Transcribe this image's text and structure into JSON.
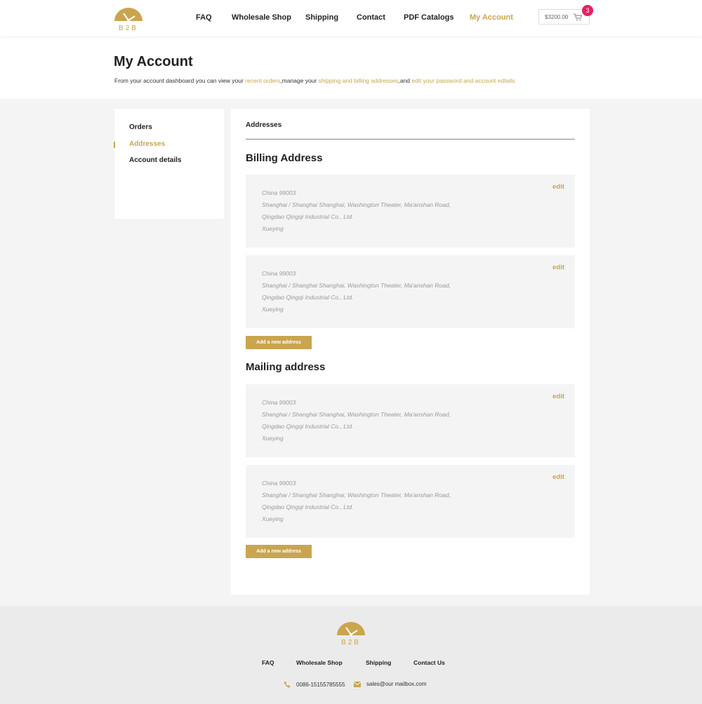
{
  "header": {
    "nav": [
      {
        "label": "FAQ",
        "active": false
      },
      {
        "label": "Wholesale Shop",
        "active": false
      },
      {
        "label": "Shipping",
        "active": false
      },
      {
        "label": "Contact",
        "active": false
      },
      {
        "label": "PDF Catalogs",
        "active": false
      },
      {
        "label": "My Account",
        "active": true
      }
    ],
    "cart_total": "$3200.00",
    "cart_count": "3",
    "logo_text": "B2B"
  },
  "page": {
    "title": "My Account",
    "intro_prefix": "From your account dashboard you can view your ",
    "intro_link1": "recent orders",
    "intro_mid1": ",manage your ",
    "intro_link2": "shipping and billing addresses",
    "intro_mid2": ",and ",
    "intro_link3": "edit your password and account edtails"
  },
  "sidebar": {
    "items": [
      {
        "label": "Orders",
        "active": false
      },
      {
        "label": "Addresses",
        "active": true
      },
      {
        "label": "Account details",
        "active": false
      }
    ]
  },
  "main": {
    "tab_label": "Addresses",
    "billing_title": "Billing Address",
    "mailing_title": "Mailing address",
    "edit_label": "edit",
    "add_button_label": "Add a new  address",
    "billing_addresses": [
      {
        "line1": "China 99003",
        "line2": "Shanghai / Shanghai Shanghai, Washington Theater, Ma'anshan Road,",
        "line3": "Qingdao Qingqi Industrial Co., Ltd.",
        "line4": "Xueying"
      },
      {
        "line1": "China 99003",
        "line2": "Shanghai / Shanghai Shanghai, Washington Theater, Ma'anshan Road,",
        "line3": "Qingdao Qingqi Industrial Co., Ltd.",
        "line4": "Xueying"
      }
    ],
    "mailing_addresses": [
      {
        "line1": "China 99003",
        "line2": "Shanghai / Shanghai Shanghai, Washington Theater, Ma'anshan Road,",
        "line3": "Qingdao Qingqi Industrial Co., Ltd.",
        "line4": "Xueying"
      },
      {
        "line1": "China 99003",
        "line2": "Shanghai / Shanghai Shanghai, Washington Theater, Ma'anshan Road,",
        "line3": "Qingdao Qingqi Industrial Co., Ltd.",
        "line4": "Xueying"
      }
    ]
  },
  "footer": {
    "nav": [
      "FAQ",
      "Wholesale Shop",
      "Shipping",
      "Contact Us"
    ],
    "phone": "0086-15155785555",
    "email": "sales@our mailbox.com",
    "logo_text": "B2B"
  },
  "colors": {
    "accent": "#c9a54e",
    "badge": "#e91e63",
    "page_bg": "#f4f4f5",
    "footer_bg": "#ebebeb"
  },
  "icons": {
    "logo": "b2b-clock-logo",
    "cart": "cart-icon",
    "phone": "phone-icon",
    "email": "envelope-icon"
  }
}
